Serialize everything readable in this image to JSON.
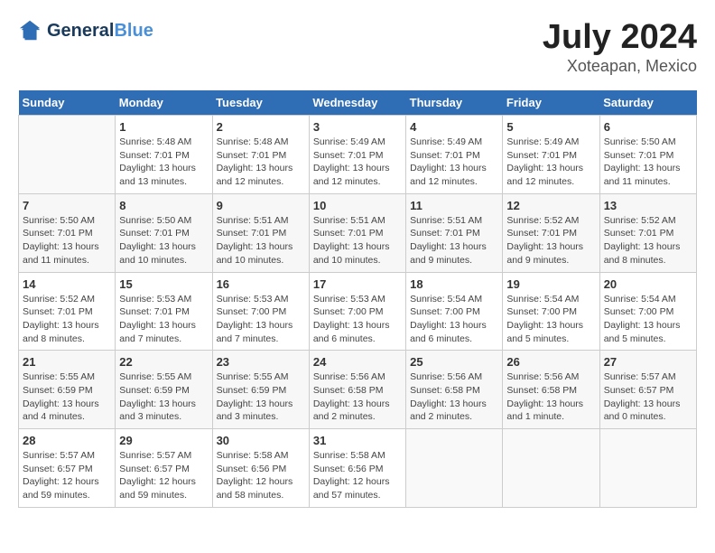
{
  "logo": {
    "text_general": "General",
    "text_blue": "Blue"
  },
  "title": "July 2024",
  "subtitle": "Xoteapan, Mexico",
  "days_of_week": [
    "Sunday",
    "Monday",
    "Tuesday",
    "Wednesday",
    "Thursday",
    "Friday",
    "Saturday"
  ],
  "weeks": [
    [
      {
        "day": "",
        "content": ""
      },
      {
        "day": "1",
        "content": "Sunrise: 5:48 AM\nSunset: 7:01 PM\nDaylight: 13 hours\nand 13 minutes."
      },
      {
        "day": "2",
        "content": "Sunrise: 5:48 AM\nSunset: 7:01 PM\nDaylight: 13 hours\nand 12 minutes."
      },
      {
        "day": "3",
        "content": "Sunrise: 5:49 AM\nSunset: 7:01 PM\nDaylight: 13 hours\nand 12 minutes."
      },
      {
        "day": "4",
        "content": "Sunrise: 5:49 AM\nSunset: 7:01 PM\nDaylight: 13 hours\nand 12 minutes."
      },
      {
        "day": "5",
        "content": "Sunrise: 5:49 AM\nSunset: 7:01 PM\nDaylight: 13 hours\nand 12 minutes."
      },
      {
        "day": "6",
        "content": "Sunrise: 5:50 AM\nSunset: 7:01 PM\nDaylight: 13 hours\nand 11 minutes."
      }
    ],
    [
      {
        "day": "7",
        "content": "Sunrise: 5:50 AM\nSunset: 7:01 PM\nDaylight: 13 hours\nand 11 minutes."
      },
      {
        "day": "8",
        "content": "Sunrise: 5:50 AM\nSunset: 7:01 PM\nDaylight: 13 hours\nand 10 minutes."
      },
      {
        "day": "9",
        "content": "Sunrise: 5:51 AM\nSunset: 7:01 PM\nDaylight: 13 hours\nand 10 minutes."
      },
      {
        "day": "10",
        "content": "Sunrise: 5:51 AM\nSunset: 7:01 PM\nDaylight: 13 hours\nand 10 minutes."
      },
      {
        "day": "11",
        "content": "Sunrise: 5:51 AM\nSunset: 7:01 PM\nDaylight: 13 hours\nand 9 minutes."
      },
      {
        "day": "12",
        "content": "Sunrise: 5:52 AM\nSunset: 7:01 PM\nDaylight: 13 hours\nand 9 minutes."
      },
      {
        "day": "13",
        "content": "Sunrise: 5:52 AM\nSunset: 7:01 PM\nDaylight: 13 hours\nand 8 minutes."
      }
    ],
    [
      {
        "day": "14",
        "content": "Sunrise: 5:52 AM\nSunset: 7:01 PM\nDaylight: 13 hours\nand 8 minutes."
      },
      {
        "day": "15",
        "content": "Sunrise: 5:53 AM\nSunset: 7:01 PM\nDaylight: 13 hours\nand 7 minutes."
      },
      {
        "day": "16",
        "content": "Sunrise: 5:53 AM\nSunset: 7:00 PM\nDaylight: 13 hours\nand 7 minutes."
      },
      {
        "day": "17",
        "content": "Sunrise: 5:53 AM\nSunset: 7:00 PM\nDaylight: 13 hours\nand 6 minutes."
      },
      {
        "day": "18",
        "content": "Sunrise: 5:54 AM\nSunset: 7:00 PM\nDaylight: 13 hours\nand 6 minutes."
      },
      {
        "day": "19",
        "content": "Sunrise: 5:54 AM\nSunset: 7:00 PM\nDaylight: 13 hours\nand 5 minutes."
      },
      {
        "day": "20",
        "content": "Sunrise: 5:54 AM\nSunset: 7:00 PM\nDaylight: 13 hours\nand 5 minutes."
      }
    ],
    [
      {
        "day": "21",
        "content": "Sunrise: 5:55 AM\nSunset: 6:59 PM\nDaylight: 13 hours\nand 4 minutes."
      },
      {
        "day": "22",
        "content": "Sunrise: 5:55 AM\nSunset: 6:59 PM\nDaylight: 13 hours\nand 3 minutes."
      },
      {
        "day": "23",
        "content": "Sunrise: 5:55 AM\nSunset: 6:59 PM\nDaylight: 13 hours\nand 3 minutes."
      },
      {
        "day": "24",
        "content": "Sunrise: 5:56 AM\nSunset: 6:58 PM\nDaylight: 13 hours\nand 2 minutes."
      },
      {
        "day": "25",
        "content": "Sunrise: 5:56 AM\nSunset: 6:58 PM\nDaylight: 13 hours\nand 2 minutes."
      },
      {
        "day": "26",
        "content": "Sunrise: 5:56 AM\nSunset: 6:58 PM\nDaylight: 13 hours\nand 1 minute."
      },
      {
        "day": "27",
        "content": "Sunrise: 5:57 AM\nSunset: 6:57 PM\nDaylight: 13 hours\nand 0 minutes."
      }
    ],
    [
      {
        "day": "28",
        "content": "Sunrise: 5:57 AM\nSunset: 6:57 PM\nDaylight: 12 hours\nand 59 minutes."
      },
      {
        "day": "29",
        "content": "Sunrise: 5:57 AM\nSunset: 6:57 PM\nDaylight: 12 hours\nand 59 minutes."
      },
      {
        "day": "30",
        "content": "Sunrise: 5:58 AM\nSunset: 6:56 PM\nDaylight: 12 hours\nand 58 minutes."
      },
      {
        "day": "31",
        "content": "Sunrise: 5:58 AM\nSunset: 6:56 PM\nDaylight: 12 hours\nand 57 minutes."
      },
      {
        "day": "",
        "content": ""
      },
      {
        "day": "",
        "content": ""
      },
      {
        "day": "",
        "content": ""
      }
    ]
  ]
}
